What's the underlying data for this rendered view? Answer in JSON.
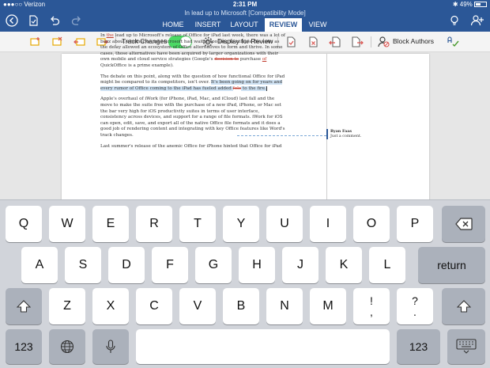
{
  "status_bar": {
    "carrier": "●●●○○ Verizon",
    "time": "2:31 PM",
    "battery": "49%"
  },
  "document_title": "In lead up to Microsoft [Compatibility Mode]",
  "nav_tabs": [
    {
      "label": "HOME",
      "active": false
    },
    {
      "label": "INSERT",
      "active": false
    },
    {
      "label": "LAYOUT",
      "active": false
    },
    {
      "label": "REVIEW",
      "active": true
    },
    {
      "label": "VIEW",
      "active": false
    }
  ],
  "ribbon": {
    "track_changes_label": "Track Changes",
    "track_changes_on": true,
    "display_for_review_label": "Display for Review",
    "block_authors_label": "Block Authors"
  },
  "document": {
    "p1_a": "In ",
    "p1_ins": "the",
    "p1_b": " lead up to Microsoft's release of Office for iPad last week, there was a lot of buzz about whether or not Microsoft had waited too long to release the suite as the delay allowed an ecosystem of Office alternatives to form and thrive. In some cases, those alternatives have been acquired by larger organizations with their own mobile and cloud service strategies (Google's ",
    "p1_del": "decision to",
    "p1_c": " purchase ",
    "p1_ins2": "of",
    "p1_d": " QuickOffice is a prime example).",
    "p2_a": "The debate on this point, along with the question of how functional Office for iPad might be compared to its competitors, isn't over. ",
    "p2_hl": "It's been going on for years and every rumor of Office coming to the iPad has fueled added ",
    "p2_del": "fole",
    "p2_b": " to the fire.",
    "p3": "Apple's overhaul of iWork (for iPhone, iPad, Mac, and iCloud) last fall and the move to make the suite free with the purchase of a new iPad, iPhone, or Mac set the bar very high for iOS productivity suites in terms of user interface, consistency across devices, and support for a range of file formats. iWork for iOS can open, edit, save, and export all of the native Office file formats and it does a good job of rendering content and integrating with key Office features like Word's track changes.",
    "p4": "Last summer's release of the anemic Office for iPhone hinted that Office for iPad"
  },
  "comment": {
    "author": "Ryan Faas",
    "text": "Just a comment."
  },
  "keyboard": {
    "row1": [
      "Q",
      "W",
      "E",
      "R",
      "T",
      "Y",
      "U",
      "I",
      "O",
      "P"
    ],
    "row2": [
      "A",
      "S",
      "D",
      "F",
      "G",
      "H",
      "J",
      "K",
      "L"
    ],
    "row3": [
      "Z",
      "X",
      "C",
      "V",
      "B",
      "N",
      "M"
    ],
    "punct1_top": "!",
    "punct1_bottom": ",",
    "punct2_top": "?",
    "punct2_bottom": ".",
    "return_label": "return",
    "numbers_label": "123"
  },
  "icons": {
    "back": "back-arrow-icon",
    "files": "file-icon",
    "undo": "undo-icon",
    "redo": "redo-icon",
    "lightbulb": "lightbulb-icon",
    "add_person": "add-person-icon",
    "delete": "backspace-icon",
    "shift": "shift-icon",
    "globe": "globe-icon",
    "mic": "microphone-icon",
    "hide": "keyboard-hide-icon"
  },
  "colors": {
    "accent": "#2b5797",
    "toggle_on": "#4cd964",
    "revision": "#c0392b"
  }
}
